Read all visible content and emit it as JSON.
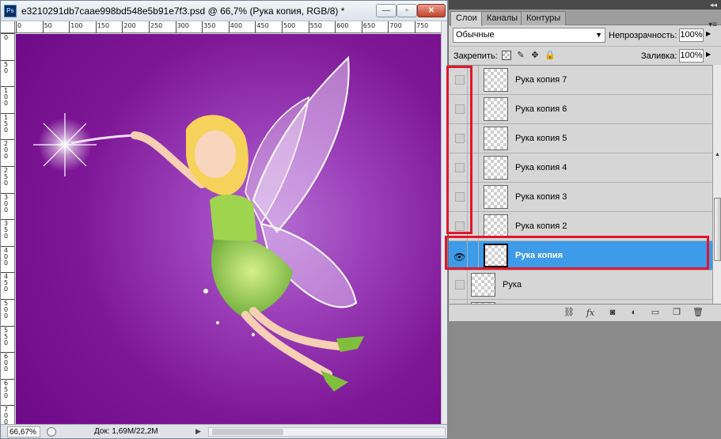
{
  "document": {
    "title": "e3210291db7caae998bd548e5b91e7f3.psd @ 66,7% (Рука копия, RGB/8) *",
    "app_badge": "Ps",
    "window_buttons": {
      "minimize": "—",
      "maximize": "▫",
      "close": "✕"
    },
    "rulers": {
      "horizontal": [
        "0",
        "50",
        "100",
        "150",
        "200",
        "250",
        "300",
        "350",
        "400",
        "450",
        "500",
        "550",
        "600",
        "650",
        "700",
        "750"
      ],
      "vertical": [
        "0",
        "50",
        "100",
        "150",
        "200",
        "250",
        "300",
        "350",
        "400",
        "450",
        "500",
        "550",
        "600",
        "650",
        "700"
      ]
    },
    "zoom": "66,67%",
    "doc_size": "Док: 1,69M/22,2M",
    "status_arrow": "▶"
  },
  "layers_panel": {
    "collapse_icon": "◂◂",
    "tabs": [
      {
        "label": "Слои",
        "active": true
      },
      {
        "label": "Каналы",
        "active": false
      },
      {
        "label": "Контуры",
        "active": false
      }
    ],
    "menu_icon": "▾≡",
    "blend_mode": "Обычные",
    "opacity_label": "Непрозрачность:",
    "opacity_value": "100%",
    "lock_label": "Закрепить:",
    "fill_label": "Заливка:",
    "fill_value": "100%",
    "layers": [
      {
        "name": "Рука копия 7",
        "visible": false,
        "selected": false,
        "clipped": true
      },
      {
        "name": "Рука копия 6",
        "visible": false,
        "selected": false,
        "clipped": true
      },
      {
        "name": "Рука копия 5",
        "visible": false,
        "selected": false,
        "clipped": true
      },
      {
        "name": "Рука копия 4",
        "visible": false,
        "selected": false,
        "clipped": true
      },
      {
        "name": "Рука копия 3",
        "visible": false,
        "selected": false,
        "clipped": true
      },
      {
        "name": "Рука копия 2",
        "visible": false,
        "selected": false,
        "clipped": true
      },
      {
        "name": "Рука копия",
        "visible": true,
        "selected": true,
        "clipped": true
      },
      {
        "name": "Рука",
        "visible": false,
        "selected": false,
        "clipped": false
      },
      {
        "name": "",
        "visible": false,
        "selected": false,
        "clipped": false
      }
    ],
    "footer_icons": [
      "link-icon",
      "fx-icon",
      "mask-icon",
      "adjustment-icon",
      "group-icon",
      "new-layer-icon",
      "trash-icon"
    ],
    "footer_glyphs": {
      "link": "⛓",
      "fx": "fx",
      "mask": "◙",
      "adjustment": "◐",
      "group": "▭",
      "new_layer": "❐",
      "trash": "🗑"
    },
    "eye_glyph": "👁"
  },
  "colors": {
    "selection": "#3d9bea",
    "highlight_red": "#e0162b",
    "canvas_purple": "#7e1796"
  }
}
